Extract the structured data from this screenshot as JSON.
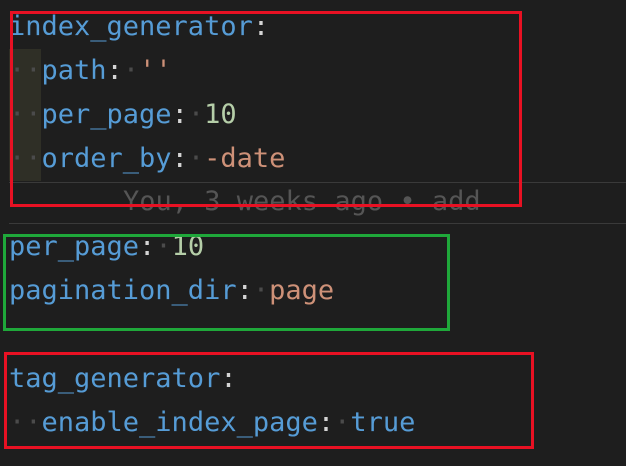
{
  "editor": {
    "lines": [
      {
        "key": "index_generator",
        "colon": ":"
      },
      {
        "key": "path",
        "colon": ":",
        "value": "''",
        "value_type": "string"
      },
      {
        "key": "per_page",
        "colon": ":",
        "value": "10",
        "value_type": "number"
      },
      {
        "key": "order_by",
        "colon": ":",
        "value": "-date",
        "value_type": "string"
      },
      {
        "key": "per_page",
        "colon": ":",
        "value": "10",
        "value_type": "number"
      },
      {
        "key": "pagination_dir",
        "colon": ":",
        "value": "page",
        "value_type": "string"
      },
      {
        "key": "tag_generator",
        "colon": ":"
      },
      {
        "key": "enable_index_page",
        "colon": ":",
        "value": "true",
        "value_type": "boolean"
      }
    ],
    "blame": "You, 3 weeks ago • add"
  },
  "colors": {
    "background": "#1e1e1e",
    "key": "#569cd6",
    "string": "#ce9178",
    "number": "#b5cea8",
    "highlight_red": "#e81123",
    "highlight_green": "#1fa83a"
  }
}
